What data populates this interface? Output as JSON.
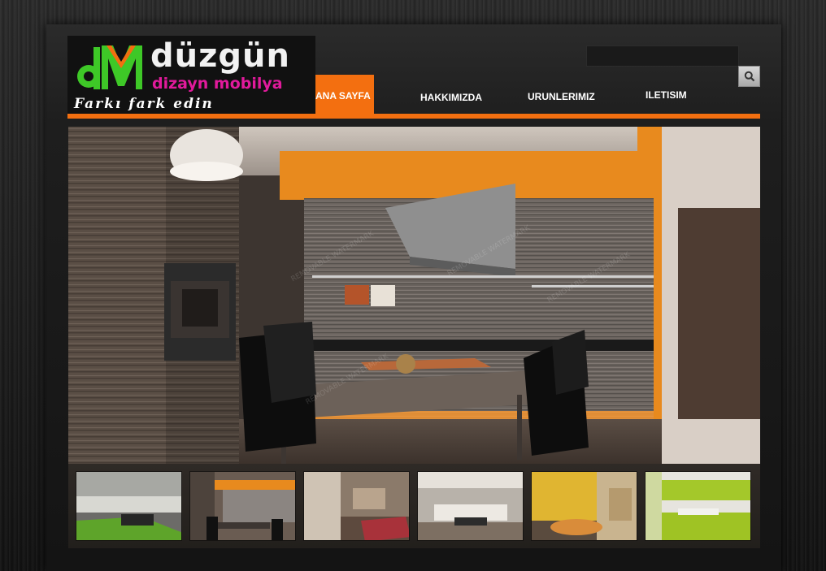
{
  "brand": {
    "name": "düzgün",
    "subtitle": "dizayn mobilya",
    "slogan": "Farkı fark edin",
    "colors": {
      "green": "#3ec827",
      "orange": "#f36f10",
      "magenta": "#e21a9c"
    }
  },
  "search": {
    "value": "",
    "placeholder": "",
    "icon": "search-icon"
  },
  "nav": {
    "items": [
      {
        "label": "ANA SAYFA",
        "active": true
      },
      {
        "label": "HAKKIMIZDA",
        "active": false
      },
      {
        "label": "URUNLERIMIZ",
        "active": false
      },
      {
        "label": "ILETISIM",
        "active": false
      }
    ]
  },
  "slideshow": {
    "current": 2,
    "thumbnails": [
      {
        "scene": "living-room-green-rug"
      },
      {
        "scene": "kitchen-orange"
      },
      {
        "scene": "bedroom-red"
      },
      {
        "scene": "living-room-white"
      },
      {
        "scene": "yellow-living-room"
      },
      {
        "scene": "green-kitchen"
      }
    ]
  }
}
